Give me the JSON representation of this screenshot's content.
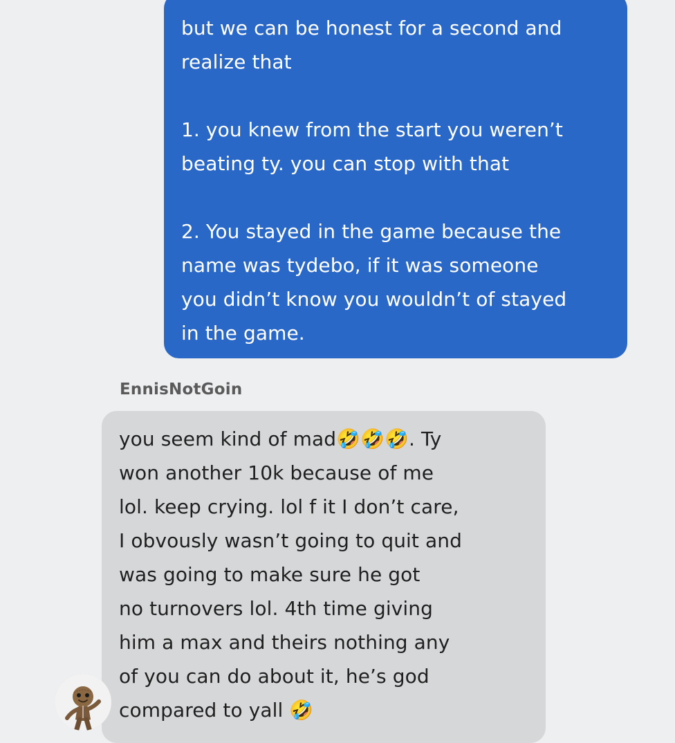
{
  "conversation": {
    "outgoing": {
      "paragraphs": [
        "but we can be honest for a second and\nrealize that",
        "1. you knew from the start you weren’t\nbeating ty. you can stop with that",
        "2. You stayed in the game because the\nname was tydebo, if it was someone\nyou didn’t know you wouldn’t of stayed\nin the game."
      ]
    },
    "incoming": {
      "sender": "EnnisNotGoin",
      "text": "you seem kind of mad🤣🤣🤣. Ty\nwon another 10k because of me\nlol. keep crying. lol f it I don’t care,\nI obvously wasn’t going to quit and\nwas going to make sure he got\nno turnovers lol. 4th time giving\nhim a max and theirs nothing any\nof you can do about it, he’s god\ncompared to yall 🤣",
      "avatar_icon": "sackboy-avatar-icon"
    }
  },
  "colors": {
    "background": "#eeeff1",
    "outgoing_bubble": "#2a68c8",
    "incoming_bubble": "#d6d7d9"
  }
}
